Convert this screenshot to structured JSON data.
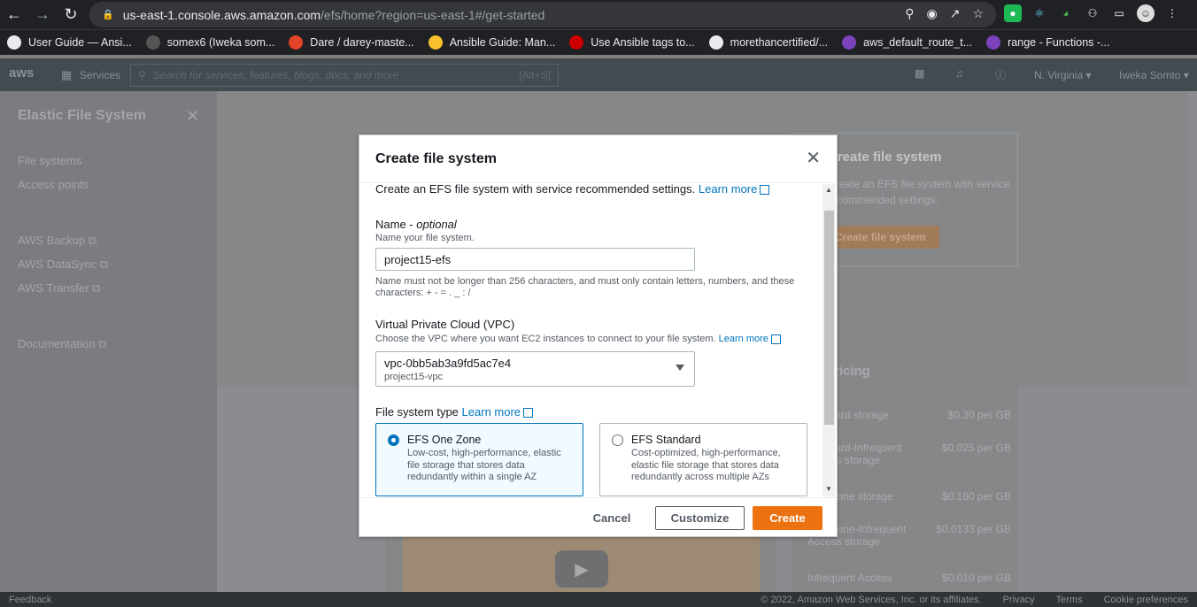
{
  "browser": {
    "url_host": "us-east-1.console.aws.amazon.com",
    "url_path": "/efs/home?region=us-east-1#/get-started",
    "bookmarks": [
      {
        "label": "User Guide — Ansi...",
        "icon": "globe-icon",
        "color": "#e8eaed"
      },
      {
        "label": "somex6 (Iweka som...",
        "icon": "github-icon",
        "color": "#555"
      },
      {
        "label": "Dare / darey-maste...",
        "icon": "gitlab-icon",
        "color": "#e24329"
      },
      {
        "label": "Ansible Guide: Man...",
        "icon": "bulb-icon",
        "color": "#fbc02d"
      },
      {
        "label": "Use Ansible tags to...",
        "icon": "redhat-icon",
        "color": "#cc0000"
      },
      {
        "label": "morethancertified/...",
        "icon": "github-icon",
        "color": "#e8eaed"
      },
      {
        "label": "aws_default_route_t...",
        "icon": "terraform-icon",
        "color": "#7b42bc"
      },
      {
        "label": "range - Functions -...",
        "icon": "terraform-icon",
        "color": "#7b42bc"
      }
    ]
  },
  "aws": {
    "services": "Services",
    "search_placeholder": "Search for services, features, blogs, docs, and more",
    "search_shortcut": "[Alt+S]",
    "region": "N. Virginia",
    "user": "Iweka Somto"
  },
  "sidebar": {
    "title": "Elastic File System",
    "items": [
      "File systems",
      "Access points"
    ],
    "links": [
      "AWS Backup",
      "AWS DataSync",
      "AWS Transfer"
    ],
    "doc": "Documentation"
  },
  "background": {
    "card_title": "Create file system",
    "card_desc": "Create an EFS file system with service recommended settings.",
    "card_button": "Create file system",
    "pricing_title": "Pricing",
    "pricing_rows": [
      {
        "label": "Standard storage",
        "price": "$0.30 per GB"
      },
      {
        "label": "Standard-Infrequent Access storage",
        "price": "$0.025 per GB"
      },
      {
        "label": "One Zone storage",
        "price": "$0.160 per GB"
      },
      {
        "label": "One Zone-Infrequent Access storage",
        "price": "$0.0133 per GB"
      },
      {
        "label": "Infrequent Access",
        "price": "$0.010 per GB"
      }
    ]
  },
  "modal": {
    "title": "Create file system",
    "intro": "Create an EFS file system with service recommended settings.",
    "learn_more": "Learn more",
    "name_label": "Name",
    "name_optional": "optional",
    "name_desc": "Name your file system.",
    "name_value": "project15-efs",
    "name_constraint": "Name must not be longer than 256 characters, and must only contain letters, numbers, and these characters: + - = . _ : /",
    "vpc_label": "Virtual Private Cloud (VPC)",
    "vpc_desc": "Choose the VPC where you want EC2 instances to connect to your file system.",
    "vpc_value": "vpc-0bb5ab3a9fd5ac7e4",
    "vpc_sub": "project15-vpc",
    "fs_type_label": "File system type",
    "tiles": [
      {
        "title": "EFS One Zone",
        "desc": "Low-cost, high-performance, elastic file storage that stores data redundantly within a single AZ",
        "selected": true
      },
      {
        "title": "EFS Standard",
        "desc": "Cost-optimized, high-performance, elastic file storage that stores data redundantly across multiple AZs",
        "selected": false
      }
    ],
    "cancel": "Cancel",
    "customize": "Customize",
    "create": "Create"
  },
  "footer": {
    "feedback": "Feedback",
    "copyright": "© 2022, Amazon Web Services, Inc. or its affiliates.",
    "privacy": "Privacy",
    "terms": "Terms",
    "cookies": "Cookie preferences"
  }
}
